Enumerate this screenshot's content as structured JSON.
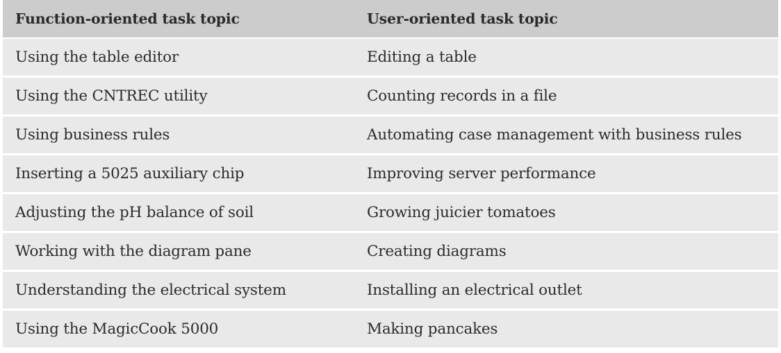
{
  "table": {
    "headers": [
      "Function-oriented task topic",
      "User-oriented task topic"
    ],
    "rows": [
      [
        "Using the table editor",
        "Editing a table"
      ],
      [
        "Using the CNTREC utility",
        "Counting records in a file"
      ],
      [
        "Using business rules",
        "Automating case management with business rules"
      ],
      [
        "Inserting a 5025 auxiliary chip",
        "Improving server performance"
      ],
      [
        "Adjusting the pH balance of soil",
        "Growing juicier tomatoes"
      ],
      [
        "Working with the diagram pane",
        "Creating diagrams"
      ],
      [
        "Understanding the electrical system",
        "Installing an electrical outlet"
      ],
      [
        "Using the MagicCook 5000",
        "Making pancakes"
      ]
    ]
  }
}
